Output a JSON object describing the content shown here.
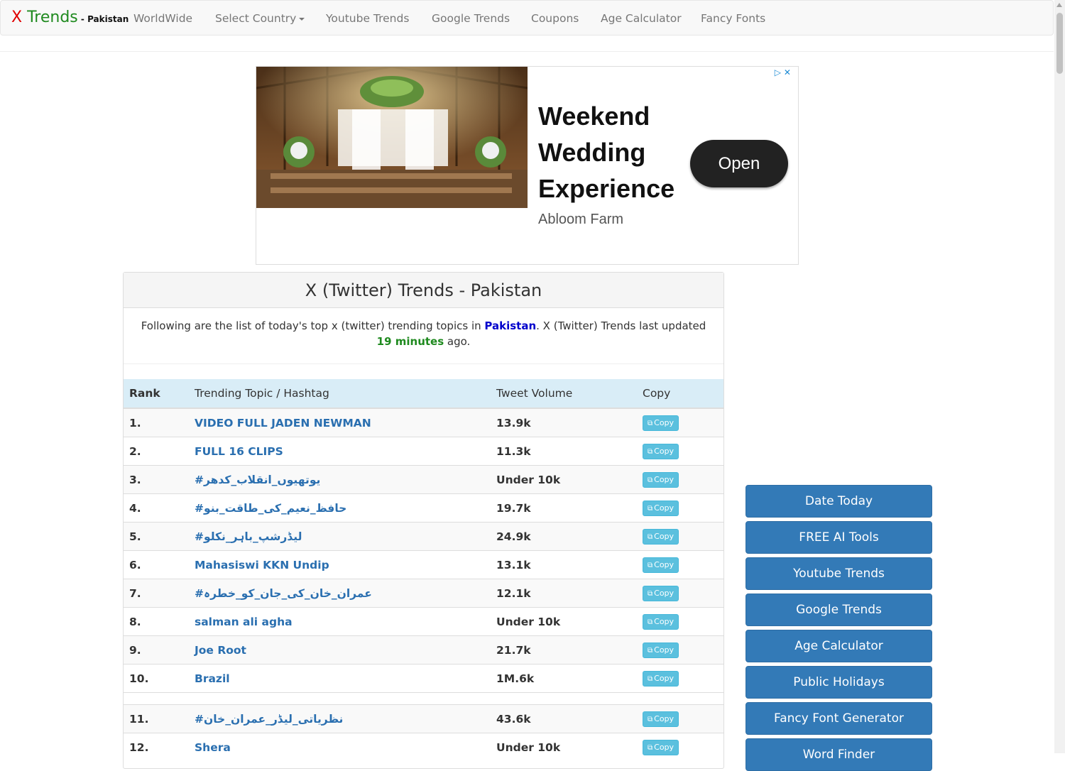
{
  "brand": {
    "x": "X",
    "trends": " Trends",
    "country": " - Pakistan"
  },
  "nav": {
    "worldwide": "WorldWide",
    "select_country": "Select Country",
    "youtube": "Youtube Trends",
    "google": "Google Trends",
    "coupons": "Coupons",
    "age": "Age Calculator",
    "fancy": "Fancy Fonts"
  },
  "ad": {
    "title": "Weekend Wedding Experience",
    "advertiser": "Abloom Farm",
    "cta": "Open",
    "icons": "▷✕"
  },
  "panel": {
    "title": "X (Twitter) Trends - Pakistan",
    "intro_pre": "Following are the list of today's top x (twitter) trending topics in ",
    "country": "Pakistan",
    "intro_mid": ". X (Twitter) Trends last updated ",
    "minutes": "19 minutes",
    "intro_post": " ago."
  },
  "table": {
    "headers": {
      "rank": "Rank",
      "topic": "Trending Topic / Hashtag",
      "volume": "Tweet Volume",
      "copy": "Copy"
    },
    "copy_label": "Copy",
    "rows": [
      {
        "rank": "1.",
        "topic": "VIDEO FULL JADEN NEWMAN",
        "volume": "13.9k"
      },
      {
        "rank": "2.",
        "topic": "FULL 16 CLIPS",
        "volume": "11.3k"
      },
      {
        "rank": "3.",
        "topic": "#یوتھیوں_انقلاب_کدھر",
        "volume": "Under 10k"
      },
      {
        "rank": "4.",
        "topic": "#حافظ_نعیم_کی_طاقت_بنو",
        "volume": "19.7k"
      },
      {
        "rank": "5.",
        "topic": "#لیڈرشپ_باہر_نکلو",
        "volume": "24.9k"
      },
      {
        "rank": "6.",
        "topic": "Mahasiswi KKN Undip",
        "volume": "13.1k"
      },
      {
        "rank": "7.",
        "topic": "#عمران_خان_کی_جان_کو_خطرہ",
        "volume": "12.1k"
      },
      {
        "rank": "8.",
        "topic": "salman ali agha",
        "volume": "Under 10k"
      },
      {
        "rank": "9.",
        "topic": "Joe Root",
        "volume": "21.7k"
      },
      {
        "rank": "10.",
        "topic": "Brazil",
        "volume": "1M.6k"
      },
      {
        "rank": "11.",
        "topic": "#نظریاتی_لیڈر_عمران_خان",
        "volume": "43.6k"
      },
      {
        "rank": "12.",
        "topic": "Shera",
        "volume": "Under 10k"
      }
    ]
  },
  "sidebar": {
    "buttons": [
      "Date Today",
      "FREE AI Tools",
      "Youtube Trends",
      "Google Trends",
      "Age Calculator",
      "Public Holidays",
      "Fancy Font Generator",
      "Word Finder"
    ]
  }
}
